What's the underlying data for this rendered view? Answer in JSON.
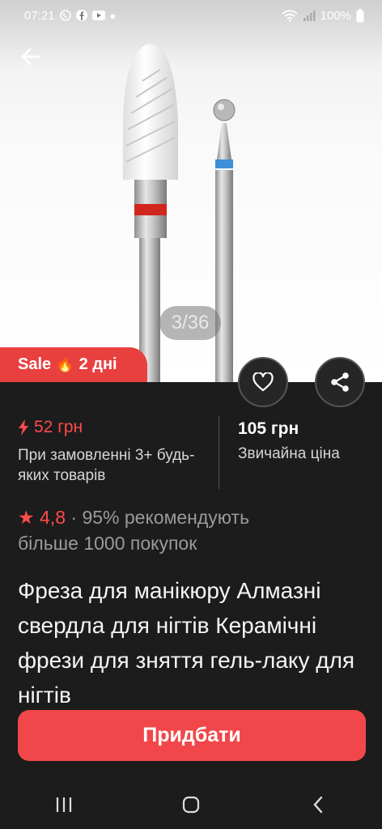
{
  "status": {
    "time": "07:21",
    "battery": "100%",
    "app_icons": [
      "viber-icon",
      "facebook-icon",
      "youtube-icon"
    ]
  },
  "gallery": {
    "counter": "3/36"
  },
  "sale": {
    "label": "Sale",
    "emoji": "🔥",
    "duration": "2 дні"
  },
  "price": {
    "sale_price": "52 грн",
    "sale_note": "При замовленні 3+ будь-яких товарів",
    "regular_price": "105 грн",
    "regular_label": "Звичайна ціна"
  },
  "rating": {
    "value": "4,8",
    "separator": "·",
    "recommend": "95% рекомендують",
    "buyers": "більше 1000 покупок"
  },
  "product": {
    "title": "Фреза для манікюру Алмазні свердла для нігтів Керамічні фрези для зняття гель-лаку для нігтів"
  },
  "actions": {
    "buy_label": "Придбати"
  },
  "colors": {
    "accent": "#f2474a",
    "price_red": "#ff4b4b",
    "background": "#1c1c1c"
  }
}
